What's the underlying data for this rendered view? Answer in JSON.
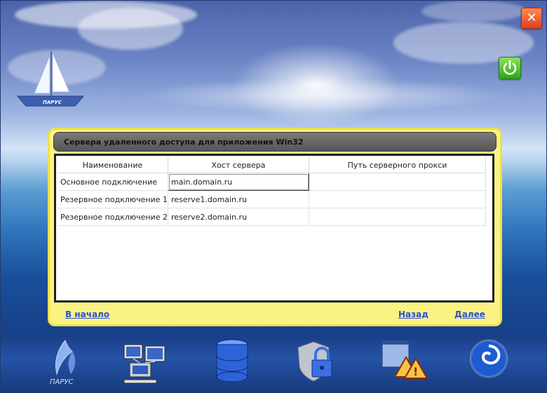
{
  "app": {
    "logo_text": "ПАРУС",
    "boat_label": "ПАРУС"
  },
  "window_buttons": {
    "close_icon": "close-icon",
    "power_icon": "power-icon"
  },
  "panel": {
    "title": "Сервера удаленного доступа для приложения Win32",
    "columns": [
      "Наименование",
      "Хост сервера",
      "Путь серверного прокси"
    ],
    "rows": [
      {
        "name": "Основное подключение",
        "host": "main.domain.ru",
        "proxy": ""
      },
      {
        "name": "Резервное подключение 1",
        "host": "reserve1.domain.ru",
        "proxy": ""
      },
      {
        "name": "Резервное подключение 2",
        "host": "reserve2.domain.ru",
        "proxy": ""
      }
    ],
    "nav": {
      "start": "В начало",
      "back": "Назад",
      "next": "Далее"
    }
  },
  "bottom_icons": [
    "parus-logo-icon",
    "network-computers-icon",
    "database-icon",
    "security-lock-icon",
    "warning-window-icon",
    "globe-icon"
  ],
  "colors": {
    "panel_bg": "#faf383",
    "link": "#2a4fd6",
    "header_bg": "#6a6a6a"
  }
}
